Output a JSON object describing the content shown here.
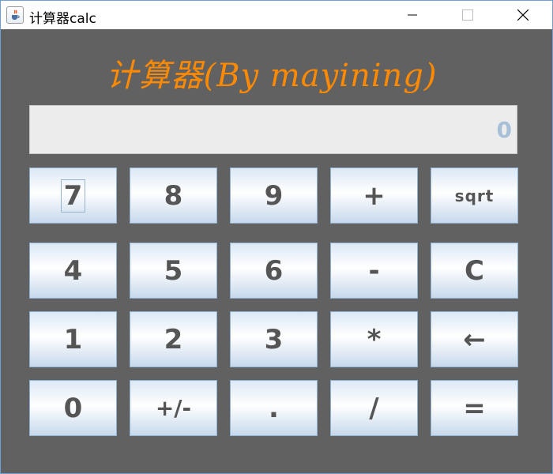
{
  "window": {
    "title": "计算器calc",
    "icons": {
      "app": "java-cup-icon",
      "minimize": "minimize-icon",
      "maximize": "maximize-icon",
      "close": "close-icon"
    }
  },
  "banner": {
    "text": "计算器(By mayining)",
    "color": "#ff8a00"
  },
  "display": {
    "value": "0"
  },
  "keys": {
    "row1": [
      "7",
      "8",
      "9",
      "+",
      "sqrt"
    ],
    "row2": [
      "4",
      "5",
      "6",
      "-",
      "C"
    ],
    "row3": [
      "1",
      "2",
      "3",
      "*",
      "←"
    ],
    "row4": [
      "0",
      "+/-",
      ".",
      "/",
      "="
    ]
  },
  "colors": {
    "background": "#616161",
    "key_border": "#8fb0cf",
    "key_text": "#555555"
  }
}
